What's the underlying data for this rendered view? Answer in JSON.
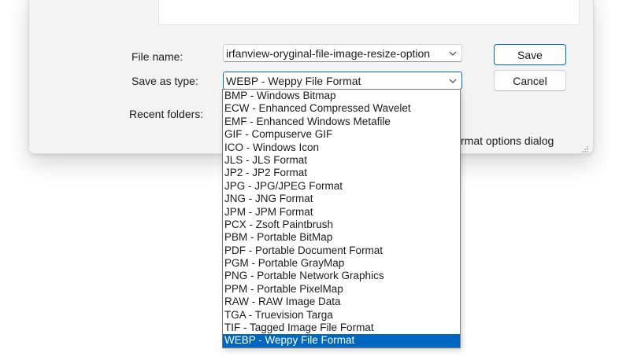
{
  "dialog": {
    "file_name_label": "File name:",
    "file_name_value": "irfanview-oryginal-file-image-resize-option",
    "save_as_type_label": "Save as type:",
    "save_as_type_value": "WEBP - Weppy File Format",
    "recent_folders_label": "Recent folders:",
    "options_checkbox_partial_label": "rmat options dialog",
    "save_button": "Save",
    "cancel_button": "Cancel"
  },
  "type_dropdown": {
    "options": [
      "BMP - Windows Bitmap",
      "ECW - Enhanced Compressed Wavelet",
      "EMF - Enhanced Windows Metafile",
      "GIF - Compuserve GIF",
      "ICO - Windows Icon",
      "JLS - JLS Format",
      "JP2 - JP2 Format",
      "JPG - JPG/JPEG Format",
      "JNG - JNG Format",
      "JPM - JPM Format",
      "PCX - Zsoft Paintbrush",
      "PBM - Portable BitMap",
      "PDF - Portable Document Format",
      "PGM - Portable GrayMap",
      "PNG - Portable Network Graphics",
      "PPM - Portable PixelMap",
      "RAW - RAW Image Data",
      "TGA - Truevision Targa",
      "TIF - Tagged Image File Format",
      "WEBP - Weppy File Format"
    ],
    "selected": "WEBP - Weppy File Format"
  },
  "colors": {
    "accent": "#0067c0",
    "dialog_bg": "#f3f3f3"
  },
  "icons": [
    "chevron-down-icon",
    "resize-grip-icon"
  ]
}
